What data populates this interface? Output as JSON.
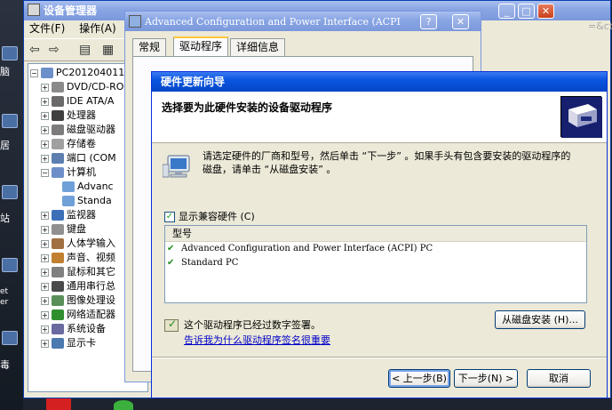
{
  "desktop": {
    "labels": [
      "脑",
      "居",
      "站",
      "et\ner",
      "毒"
    ]
  },
  "device_manager": {
    "title": "设备管理器",
    "menu": [
      "文件(F)",
      "操作(A)"
    ],
    "tree": {
      "root": "PC2012040111",
      "items": [
        {
          "label": "DVD/CD-RO",
          "expand": "+"
        },
        {
          "label": "IDE ATA/A",
          "expand": "+"
        },
        {
          "label": "处理器",
          "expand": "+"
        },
        {
          "label": "磁盘驱动器",
          "expand": "+"
        },
        {
          "label": "存储卷",
          "expand": "+"
        },
        {
          "label": "端口 (COM",
          "expand": "+"
        },
        {
          "label": "计算机",
          "expand": "-"
        },
        {
          "label": "Advanc",
          "child": true
        },
        {
          "label": "Standa",
          "child": true
        },
        {
          "label": "监视器",
          "expand": "+"
        },
        {
          "label": "键盘",
          "expand": "+"
        },
        {
          "label": "人体学输入",
          "expand": "+"
        },
        {
          "label": "声音、视频",
          "expand": "+"
        },
        {
          "label": "鼠标和其它",
          "expand": "+"
        },
        {
          "label": "通用串行总",
          "expand": "+"
        },
        {
          "label": "图像处理设",
          "expand": "+"
        },
        {
          "label": "网络适配器",
          "expand": "+"
        },
        {
          "label": "系统设备",
          "expand": "+"
        },
        {
          "label": "显示卡",
          "expand": "+"
        }
      ]
    },
    "right_text": "=&ct"
  },
  "properties": {
    "title": "Advanced Configuration and Power Interface (ACPI",
    "tabs": [
      "常规",
      "驱动程序",
      "详细信息"
    ],
    "active_tab": 1
  },
  "wizard": {
    "title": "硬件更新向导",
    "heading": "选择要为此硬件安装的设备驱动程序",
    "instruction": "请选定硬件的厂商和型号，然后单击 “下一步” 。如果手头有包含要安装的驱动程序的磁盘，请单击 “从磁盘安装” 。",
    "show_compatible_label": "显示兼容硬件 (C)",
    "show_compatible_checked": true,
    "list_header": "型号",
    "models": [
      "Advanced Configuration and Power Interface (ACPI) PC",
      "Standard PC"
    ],
    "signed_text": "这个驱动程序已经过数字签署。",
    "signing_link": "告诉我为什么驱动程序签名很重要",
    "have_disk_button": "从磁盘安装 (H)...",
    "back_button": "< 上一步(B)",
    "next_button": "下一步(N) >",
    "cancel_button": "取消"
  }
}
